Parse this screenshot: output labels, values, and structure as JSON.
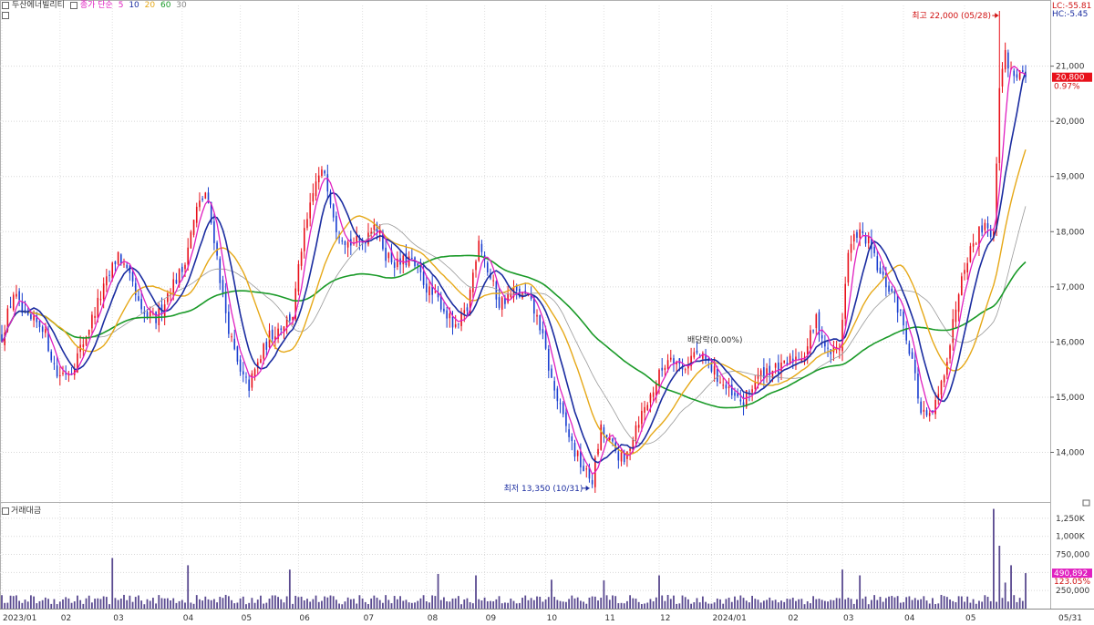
{
  "header": {
    "stock_name": "두산에너빌리티",
    "ma_label": "종가 단순",
    "ma_periods": [
      "5",
      "10",
      "20",
      "60",
      "30"
    ],
    "ma_colors": [
      "#e020c0",
      "#1a2ca0",
      "#e6a817",
      "#1a9a28",
      "#888888"
    ]
  },
  "right_labels": {
    "lc": "LC:-55.81",
    "hc": "HC:-5.45",
    "last_price": "20,800",
    "change_pct": "0.97%",
    "volume_last": "490,892",
    "volume_pct": "123.05%"
  },
  "annotations": {
    "high": "최고 22,000 (05/28)",
    "low": "최저 13,350 (10/31)",
    "dividend": "배당락(0.00%)"
  },
  "volume_panel": {
    "title": "거래대금"
  },
  "chart_data": {
    "type": "candlestick",
    "price_axis": {
      "ticks": [
        "14,000",
        "15,000",
        "16,000",
        "17,000",
        "18,000",
        "19,000",
        "20,000",
        "21,000"
      ],
      "values": [
        14000,
        15000,
        16000,
        17000,
        18000,
        19000,
        20000,
        21000
      ],
      "range": [
        13100,
        22100
      ]
    },
    "volume_axis": {
      "ticks": [
        "250,000",
        "500,000",
        "750,000",
        "1,000K",
        "1,250K"
      ],
      "values": [
        250000,
        500000,
        750000,
        1000000,
        1250000
      ],
      "range": [
        0,
        1450000
      ]
    },
    "x_ticks": [
      "2023/01",
      "02",
      "03",
      "04",
      "05",
      "06",
      "07",
      "08",
      "09",
      "10",
      "11",
      "12",
      "2024/01",
      "02",
      "03",
      "04",
      "05",
      "05/31"
    ],
    "x_tick_positions": [
      0,
      20,
      38,
      62,
      82,
      102,
      124,
      146,
      166,
      187,
      207,
      226,
      244,
      270,
      289,
      310,
      331,
      361
    ],
    "n_days": 353,
    "price_keypoints": [
      [
        0,
        16100
      ],
      [
        4,
        16900
      ],
      [
        8,
        16400
      ],
      [
        14,
        16300
      ],
      [
        19,
        15400
      ],
      [
        24,
        15500
      ],
      [
        28,
        16000
      ],
      [
        33,
        16700
      ],
      [
        40,
        17600
      ],
      [
        45,
        17000
      ],
      [
        48,
        16500
      ],
      [
        53,
        16400
      ],
      [
        58,
        17000
      ],
      [
        62,
        17300
      ],
      [
        67,
        18400
      ],
      [
        70,
        18700
      ],
      [
        73,
        17900
      ],
      [
        76,
        16800
      ],
      [
        79,
        16000
      ],
      [
        82,
        15400
      ],
      [
        85,
        15200
      ],
      [
        88,
        15600
      ],
      [
        92,
        16100
      ],
      [
        96,
        16300
      ],
      [
        100,
        16500
      ],
      [
        103,
        17700
      ],
      [
        108,
        18900
      ],
      [
        111,
        19100
      ],
      [
        115,
        18100
      ],
      [
        119,
        17800
      ],
      [
        124,
        17800
      ],
      [
        128,
        18200
      ],
      [
        132,
        17600
      ],
      [
        136,
        17400
      ],
      [
        140,
        17500
      ],
      [
        144,
        17200
      ],
      [
        147,
        16900
      ],
      [
        151,
        16700
      ],
      [
        156,
        16200
      ],
      [
        160,
        16600
      ],
      [
        164,
        17900
      ],
      [
        167,
        17300
      ],
      [
        171,
        16700
      ],
      [
        176,
        16900
      ],
      [
        181,
        16800
      ],
      [
        185,
        16300
      ],
      [
        189,
        15300
      ],
      [
        193,
        14600
      ],
      [
        197,
        14000
      ],
      [
        201,
        13600
      ],
      [
        203,
        13500
      ],
      [
        206,
        14400
      ],
      [
        210,
        14100
      ],
      [
        214,
        13800
      ],
      [
        218,
        14500
      ],
      [
        222,
        14900
      ],
      [
        226,
        15400
      ],
      [
        230,
        15800
      ],
      [
        234,
        15500
      ],
      [
        238,
        15800
      ],
      [
        243,
        15600
      ],
      [
        247,
        15300
      ],
      [
        251,
        15000
      ],
      [
        255,
        14900
      ],
      [
        259,
        15300
      ],
      [
        263,
        15500
      ],
      [
        268,
        15500
      ],
      [
        272,
        15700
      ],
      [
        276,
        15800
      ],
      [
        280,
        16400
      ],
      [
        284,
        15800
      ],
      [
        288,
        15900
      ],
      [
        291,
        17600
      ],
      [
        294,
        18000
      ],
      [
        298,
        17800
      ],
      [
        302,
        17200
      ],
      [
        306,
        16900
      ],
      [
        309,
        16500
      ],
      [
        313,
        15700
      ],
      [
        316,
        14700
      ],
      [
        319,
        14600
      ],
      [
        322,
        15000
      ],
      [
        326,
        16000
      ],
      [
        330,
        17300
      ],
      [
        334,
        17800
      ],
      [
        338,
        18200
      ],
      [
        341,
        17900
      ],
      [
        343,
        20700
      ],
      [
        345,
        21200
      ],
      [
        347,
        20900
      ],
      [
        352,
        20800
      ]
    ],
    "high": {
      "value": 22000,
      "date": "05/28"
    },
    "low": {
      "value": 13350,
      "date": "10/31"
    },
    "volume_spikes": [
      [
        38,
        700000
      ],
      [
        64,
        600000
      ],
      [
        99,
        540000
      ],
      [
        150,
        480000
      ],
      [
        163,
        460000
      ],
      [
        189,
        400000
      ],
      [
        207,
        390000
      ],
      [
        226,
        460000
      ],
      [
        289,
        540000
      ],
      [
        295,
        460000
      ],
      [
        341,
        1380000
      ],
      [
        343,
        870000
      ],
      [
        345,
        360000
      ],
      [
        347,
        600000
      ]
    ],
    "moving_averages": [
      5,
      10,
      20,
      60,
      30
    ],
    "last_close": 20800,
    "last_volume": 490892
  }
}
